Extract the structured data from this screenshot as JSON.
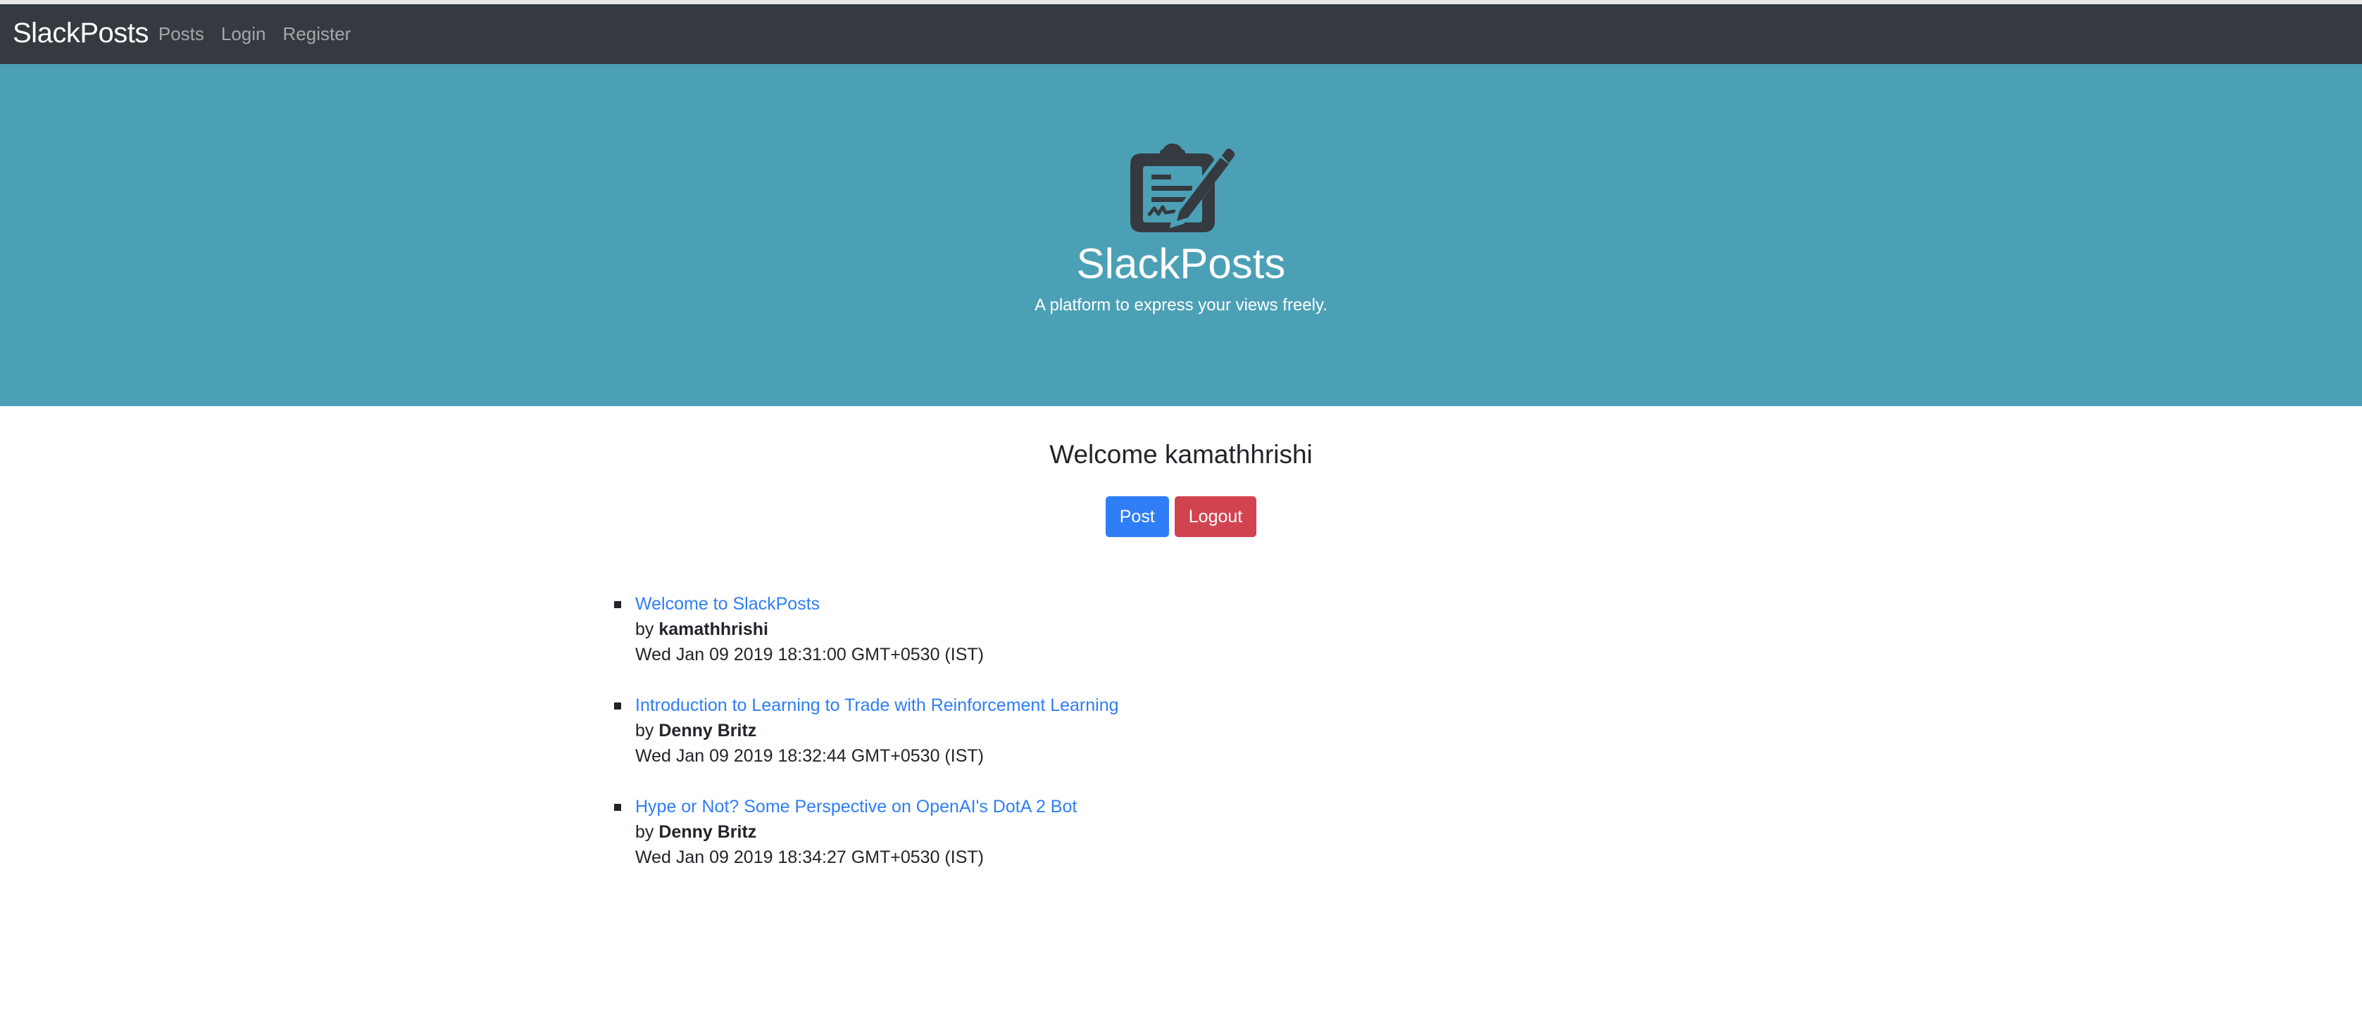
{
  "navbar": {
    "brand": "SlackPosts",
    "links": [
      "Posts",
      "Login",
      "Register"
    ]
  },
  "hero": {
    "icon": "signed-document-icon",
    "title": "SlackPosts",
    "subtitle": "A platform to express your views freely."
  },
  "main": {
    "welcome": "Welcome kamathhrishi",
    "buttons": {
      "post": "Post",
      "logout": "Logout"
    },
    "by_label": "by",
    "posts": [
      {
        "title": "Welcome to SlackPosts",
        "author": "kamathhrishi",
        "date": "Wed Jan 09 2019 18:31:00 GMT+0530 (IST)"
      },
      {
        "title": "Introduction to Learning to Trade with Reinforcement Learning",
        "author": "Denny Britz",
        "date": "Wed Jan 09 2019 18:32:44 GMT+0530 (IST)"
      },
      {
        "title": "Hype or Not? Some Perspective on OpenAI's DotA 2 Bot",
        "author": "Denny Britz",
        "date": "Wed Jan 09 2019 18:34:27 GMT+0530 (IST)"
      }
    ]
  },
  "colors": {
    "navbar": "#343a40",
    "hero": "#4ca0b6",
    "primary": "#2f7ef6",
    "danger": "#d1444f"
  }
}
